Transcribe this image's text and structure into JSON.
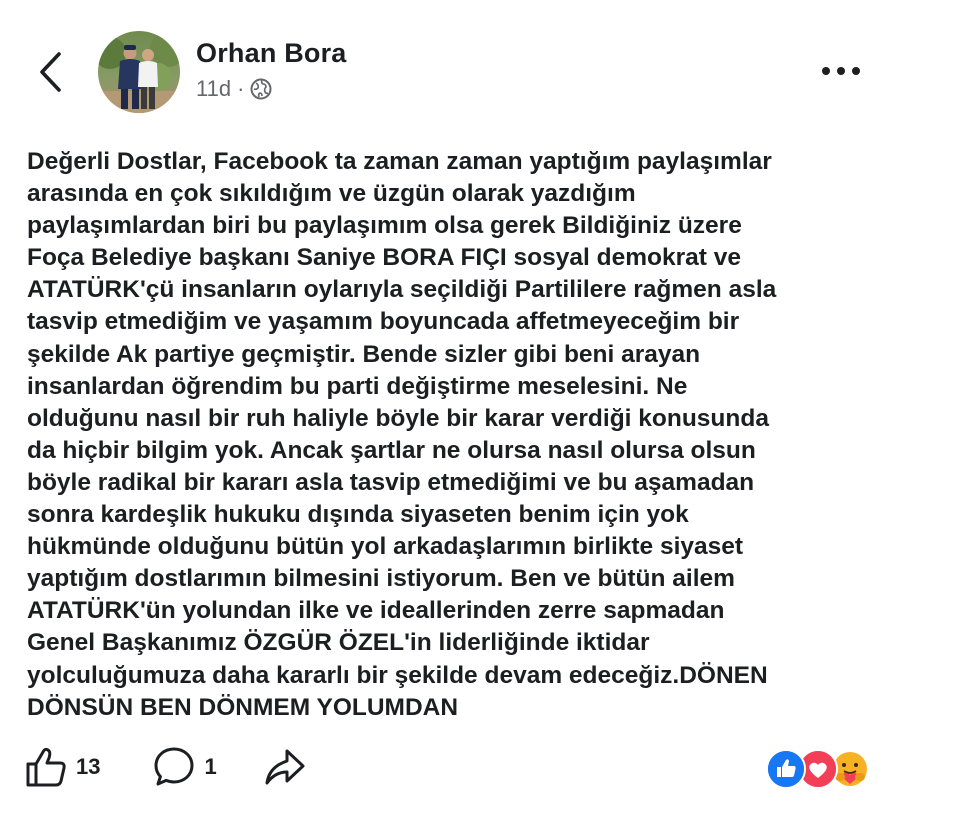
{
  "header": {
    "author_name": "Orhan Bora",
    "timestamp": "11d",
    "separator": "·",
    "audience_icon": "globe-icon"
  },
  "post": {
    "lines": [
      "Değerli Dostlar, Facebook ta zaman zaman yaptığım  paylaşımlar",
      "arasında en çok sıkıldığım ve üzgün olarak yazdığım",
      "paylaşımlardan biri bu paylaşımım olsa gerek Bildiğiniz üzere",
      "Foça Belediye başkanı Saniye BORA FIÇI sosyal demokrat ve",
      "ATATÜRK'çü insanların oylarıyla seçildiği Partililere rağmen asla",
      "tasvip etmediğim ve yaşamım boyuncada affetmeyeceğim bir",
      "şekilde Ak partiye geçmiştir. Bende sizler gibi beni arayan",
      "insanlardan öğrendim bu parti değiştirme meselesini. Ne",
      "olduğunu nasıl bir ruh haliyle böyle bir karar verdiği konusunda",
      "da hiçbir bilgim yok. Ancak şartlar ne olursa nasıl olursa olsun",
      "böyle radikal bir kararı asla tasvip etmediğimi ve bu aşamadan",
      "sonra kardeşlik hukuku dışında siyaseten benim için yok",
      "hükmünde olduğunu bütün yol arkadaşlarımın  birlikte siyaset",
      "yaptığım dostlarımın bilmesini istiyorum. Ben ve bütün ailem",
      "ATATÜRK'ün yolundan ilke ve ideallerinden zerre sapmadan",
      "Genel Başkanımız ÖZGÜR ÖZEL'in liderliğinde iktidar",
      "yolculuğumuza daha kararlı bir şekilde devam edeceğiz.DÖNEN",
      "DÖNSÜN BEN DÖNMEM YOLUMDAN"
    ]
  },
  "actions": {
    "like_count": "13",
    "comment_count": "1",
    "like_icon": "thumbs-up-icon",
    "comment_icon": "comment-bubble-icon",
    "share_icon": "share-arrow-icon"
  },
  "reactions": [
    "like-reaction-icon",
    "love-reaction-icon",
    "care-reaction-icon"
  ],
  "colors": {
    "text": "#1c1e21",
    "secondary_text": "#65676b",
    "like_blue": "#1877f2",
    "love_red": "#f33e58",
    "care_yellow": "#f7b125"
  }
}
